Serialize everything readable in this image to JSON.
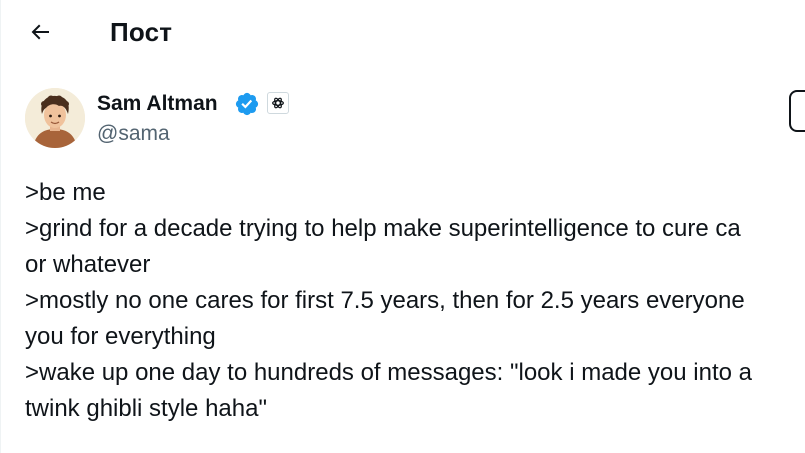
{
  "header": {
    "title": "Пост",
    "back_icon": "arrow-left-icon"
  },
  "author": {
    "name": "Sam Altman",
    "handle": "@sama",
    "verified_color": "#1d9bf0",
    "affiliation_icon": "openai-logo-icon"
  },
  "tweet": {
    "lines": [
      ">be me",
      ">grind for a decade trying to help make superintelligence to cure ca",
      "or whatever",
      ">mostly no one cares for first 7.5 years, then for 2.5 years everyone",
      "you for everything",
      ">wake up one day to hundreds of messages: \"look i made you into a",
      "twink ghibli style haha\""
    ]
  },
  "colors": {
    "text": "#0f1419",
    "secondary": "#536471",
    "accent": "#1d9bf0",
    "border": "#eff3f4"
  }
}
